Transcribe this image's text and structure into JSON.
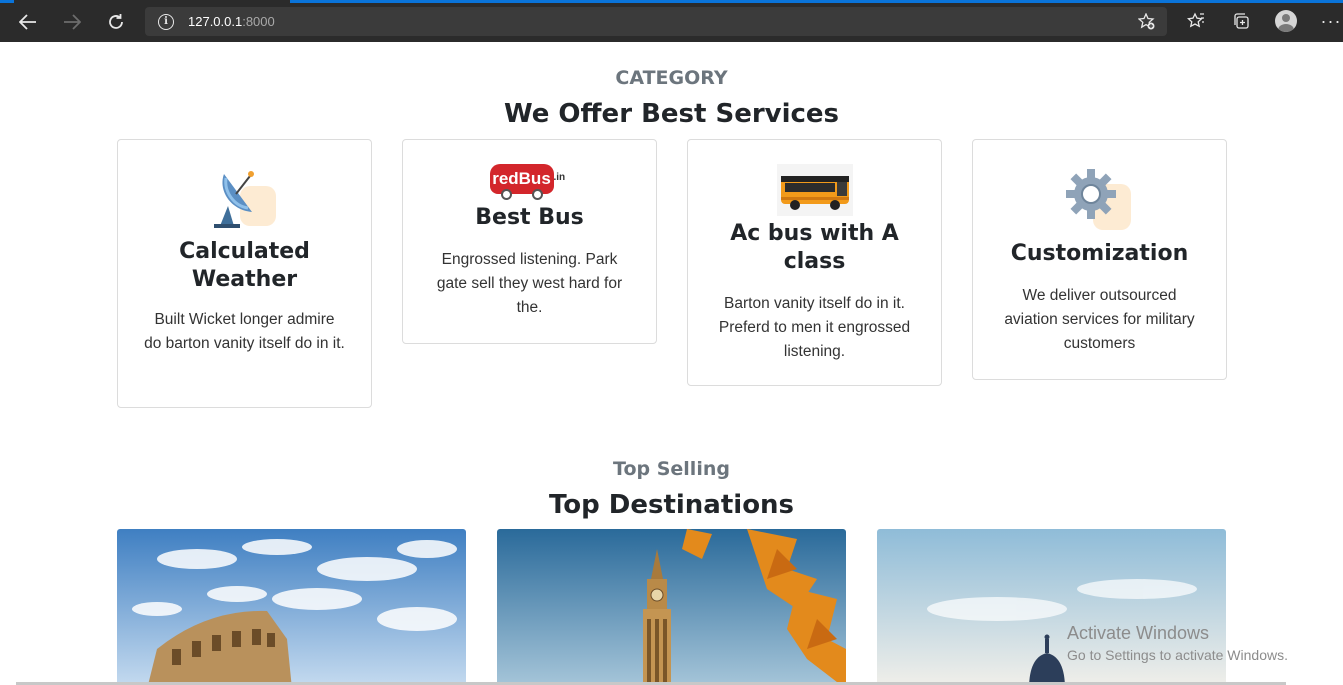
{
  "browser": {
    "url_host": "127.0.0.1",
    "url_port": ":8000"
  },
  "category": {
    "subtitle": "CATEGORY",
    "title": "We Offer Best Services",
    "cards": [
      {
        "icon": "satellite-dish-icon",
        "title": "Calculated Weather",
        "text": "Built Wicket longer admire do barton vanity itself do in it."
      },
      {
        "icon": "redbus-logo",
        "logo_text": "redBus",
        "logo_suffix": ".in",
        "title": "Best Bus",
        "text": "Engrossed listening. Park gate sell they west hard for the."
      },
      {
        "icon": "bus-image",
        "title": "Ac bus with A class",
        "text": "Barton vanity itself do in it. Preferd to men it engrossed listening."
      },
      {
        "icon": "gear-icon",
        "title": "Customization",
        "text": "We deliver outsourced aviation services for military customers"
      }
    ]
  },
  "destinations": {
    "subtitle": "Top Selling",
    "title": "Top Destinations",
    "images": [
      "colosseum-image",
      "big-ben-image",
      "dome-city-image"
    ]
  },
  "watermark": {
    "line1": "Activate Windows",
    "line2": "Go to Settings to activate Windows."
  },
  "colors": {
    "chrome_bg": "#2b2b2b",
    "accent_blue": "#0a74da",
    "muted_text": "#6c757d",
    "card_border": "#dcdcdc",
    "icon_blob": "#fdebd3"
  }
}
